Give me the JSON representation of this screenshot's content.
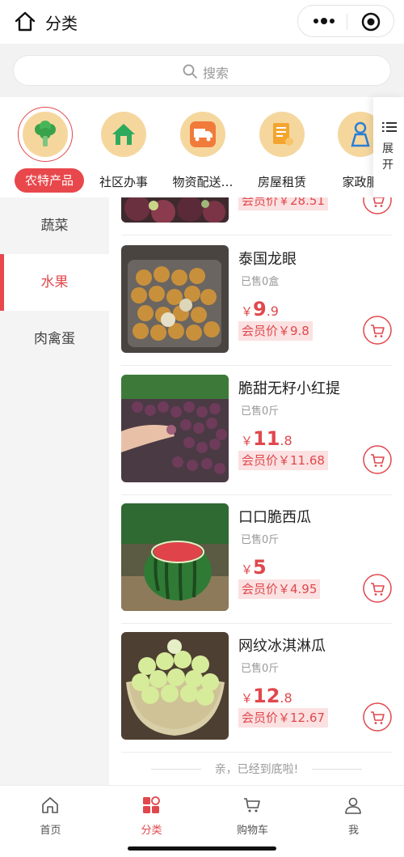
{
  "header": {
    "title": "分类"
  },
  "search": {
    "placeholder": "搜索"
  },
  "categories": [
    {
      "label": "农特产品",
      "icon": "broccoli-icon",
      "active": true
    },
    {
      "label": "社区办事",
      "icon": "house-icon"
    },
    {
      "label": "物资配送…",
      "icon": "delivery-truck-icon"
    },
    {
      "label": "房屋租赁",
      "icon": "contract-icon"
    },
    {
      "label": "家政服",
      "icon": "cleaner-icon"
    }
  ],
  "expand": {
    "label": "展开"
  },
  "sidebar": {
    "items": [
      {
        "label": "蔬菜"
      },
      {
        "label": "水果",
        "active": true
      },
      {
        "label": "肉禽蛋"
      }
    ]
  },
  "products": {
    "partial": {
      "member_price": "会员价￥28.51"
    },
    "items": [
      {
        "name": "泰国龙眼",
        "sold": "已售0盒",
        "yen": "￥",
        "price_int": "9",
        "price_dec": ".9",
        "member_price": "会员价￥9.8"
      },
      {
        "name": "脆甜无籽小红提",
        "sold": "已售0斤",
        "yen": "￥",
        "price_int": "11",
        "price_dec": ".8",
        "member_price": "会员价￥11.68"
      },
      {
        "name": "口口脆西瓜",
        "sold": "已售0斤",
        "yen": "￥",
        "price_int": "5",
        "price_dec": "",
        "member_price": "会员价￥4.95"
      },
      {
        "name": "网纹冰淇淋瓜",
        "sold": "已售0斤",
        "yen": "￥",
        "price_int": "12",
        "price_dec": ".8",
        "member_price": "会员价￥12.67"
      }
    ]
  },
  "end_note": "亲，已经到底啦!",
  "tabbar": {
    "items": [
      {
        "label": "首页"
      },
      {
        "label": "分类",
        "active": true
      },
      {
        "label": "购物车"
      },
      {
        "label": "我"
      }
    ]
  },
  "colors": {
    "accent": "#e0484d",
    "member_bg": "#fbe1e1",
    "icon_bg": "#f5d79e"
  }
}
